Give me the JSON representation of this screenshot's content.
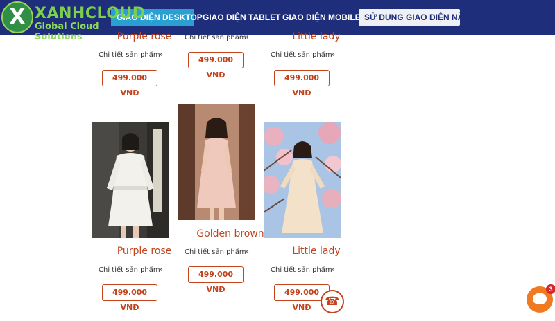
{
  "header": {
    "logo_mark": "X",
    "logo_name": "XANHCLOUD",
    "logo_tagline": "Global Cloud Solutions",
    "nav": {
      "desktop": "GIAO DIỆN DESKTOP",
      "tablet": "GIAO DIỆN TABLET",
      "mobile": "GIAO DIỆN MOBILE",
      "use": "SỬ DỤNG GIAO DIỆN NÀY"
    }
  },
  "detail_label": "Chi tiết sản phẩm",
  "chevron_icon": "double-chevron-down-icon",
  "products_top": [
    {
      "name": "Purple rose",
      "price": "499.000 VNĐ"
    },
    {
      "name": "",
      "price": "499.000 VNĐ"
    },
    {
      "name": "Little lady",
      "price": "499.000 VNĐ"
    }
  ],
  "products_bottom": [
    {
      "name": "Purple rose",
      "price": "499.000 VNĐ"
    },
    {
      "name": "Golden brown",
      "price": "499.000 VNĐ"
    },
    {
      "name": "Little lady",
      "price": "499.000 VNĐ"
    }
  ],
  "floating": {
    "phone_icon": "phone-icon",
    "chat_badge_count": "3"
  },
  "colors": {
    "nav_bg": "#1f2e7a",
    "nav_active": "#2a9fd1",
    "accent": "#c2431c",
    "chat": "#f07a22"
  }
}
